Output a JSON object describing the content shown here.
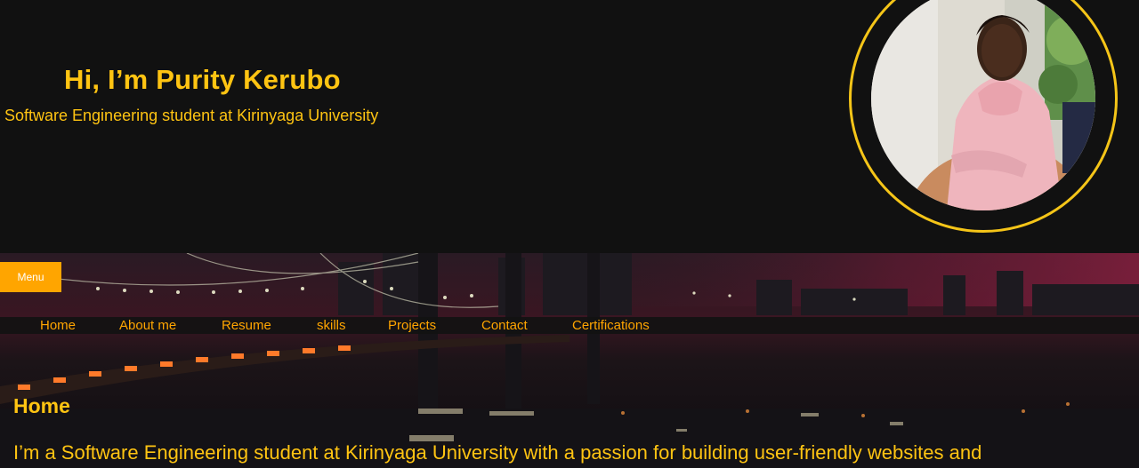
{
  "hero": {
    "title": "Hi, I’m Purity Kerubo",
    "subtitle": "Software Engineering student at Kirinyaga University"
  },
  "menu_button": {
    "label": "Menu"
  },
  "nav": {
    "items": [
      {
        "label": "Home"
      },
      {
        "label": "About me"
      },
      {
        "label": "Resume"
      },
      {
        "label": "skills"
      },
      {
        "label": "Projects"
      },
      {
        "label": "Contact"
      },
      {
        "label": "Certifications"
      }
    ]
  },
  "home": {
    "heading": "Home",
    "intro": "I’m a Software Engineering student at Kirinyaga University with a passion for building user-friendly websites and"
  },
  "colors": {
    "accent": "#FFC412",
    "nav_text": "#FFA500",
    "menu_button": "#FFA500",
    "ring": "#F5C518",
    "background": "#111111"
  },
  "icons": {
    "avatar": "profile-photo",
    "banner": "night-bridge-cityscape"
  }
}
